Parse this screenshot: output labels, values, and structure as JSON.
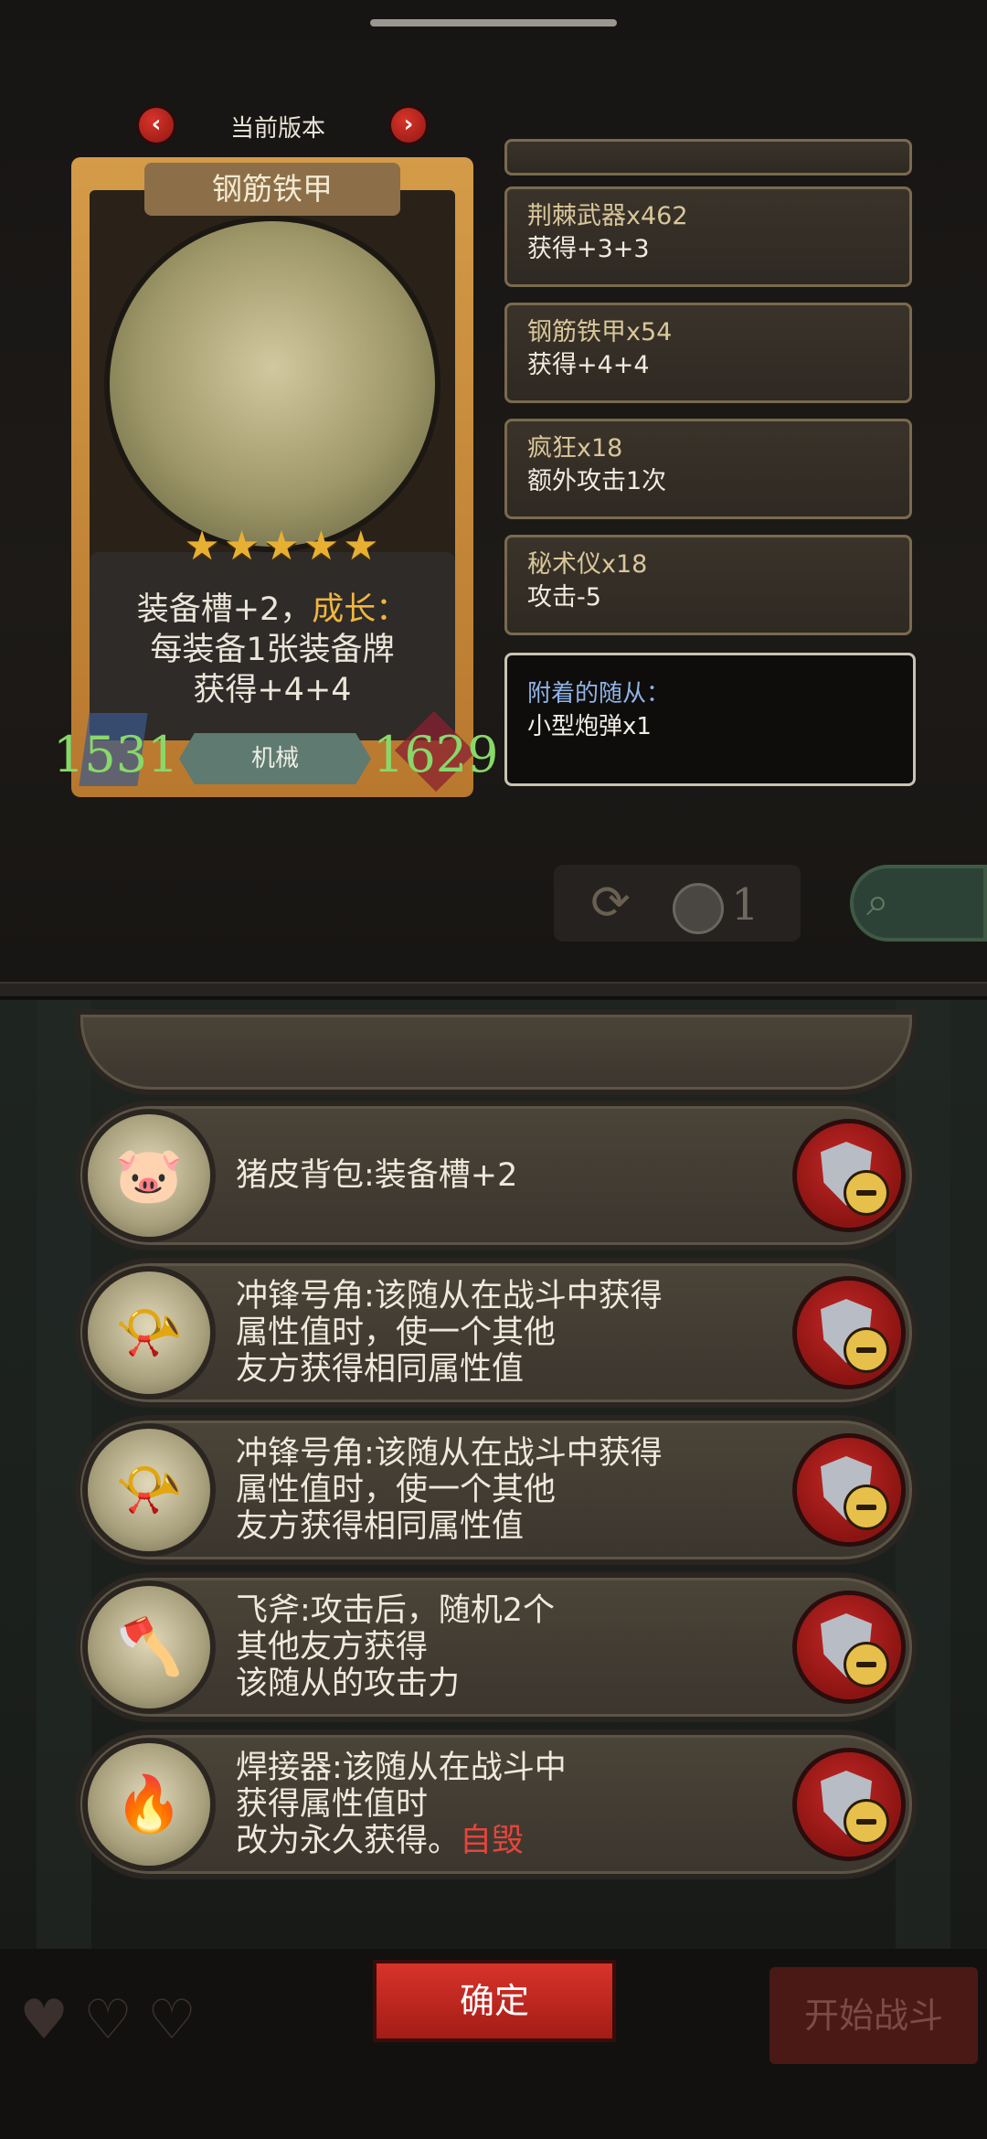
{
  "version": {
    "label": "当前版本"
  },
  "card": {
    "name": "钢筋铁甲",
    "stars": "★★★★★",
    "desc_line1_prefix": "装备槽+2，",
    "desc_line1_growth": "成长：",
    "desc_line2": "每装备1张装备牌",
    "desc_line3": "获得+4+4",
    "attack": "1531",
    "health": "1629",
    "tribe": "机械"
  },
  "buffs": [
    {
      "name": "荆棘武器x462",
      "effect": "获得+3+3"
    },
    {
      "name": "钢筋铁甲x54",
      "effect": "获得+4+4"
    },
    {
      "name": "疯狂x18",
      "effect": "额外攻击1次"
    },
    {
      "name": "秘术仪x18",
      "effect": "攻击-5"
    }
  ],
  "attached": {
    "title": "附着的随从：",
    "item": "小型炮弹x1"
  },
  "controls": {
    "coin_count": "1"
  },
  "equipment": [
    {
      "lines": [
        "猪皮背包:装备槽+2"
      ],
      "icon": "pig-backpack-icon"
    },
    {
      "lines": [
        "冲锋号角:该随从在战斗中获得",
        "属性值时，使一个其他",
        "友方获得相同属性值"
      ],
      "icon": "horn-icon"
    },
    {
      "lines": [
        "冲锋号角:该随从在战斗中获得",
        "属性值时，使一个其他",
        "友方获得相同属性值"
      ],
      "icon": "horn-icon"
    },
    {
      "lines": [
        "飞斧:攻击后，随机2个",
        "其他友方获得",
        "该随从的攻击力"
      ],
      "icon": "axe-icon"
    },
    {
      "lines": [
        "焊接器:该随从在战斗中",
        "获得属性值时",
        "改为永久获得。"
      ],
      "tag": "自毁",
      "icon": "welder-icon"
    }
  ],
  "buttons": {
    "confirm": "确定",
    "start": "开始战斗"
  },
  "colors": {
    "accent_red": "#d8332a",
    "stat_green": "#88d86a",
    "growth_gold": "#f0b640"
  }
}
